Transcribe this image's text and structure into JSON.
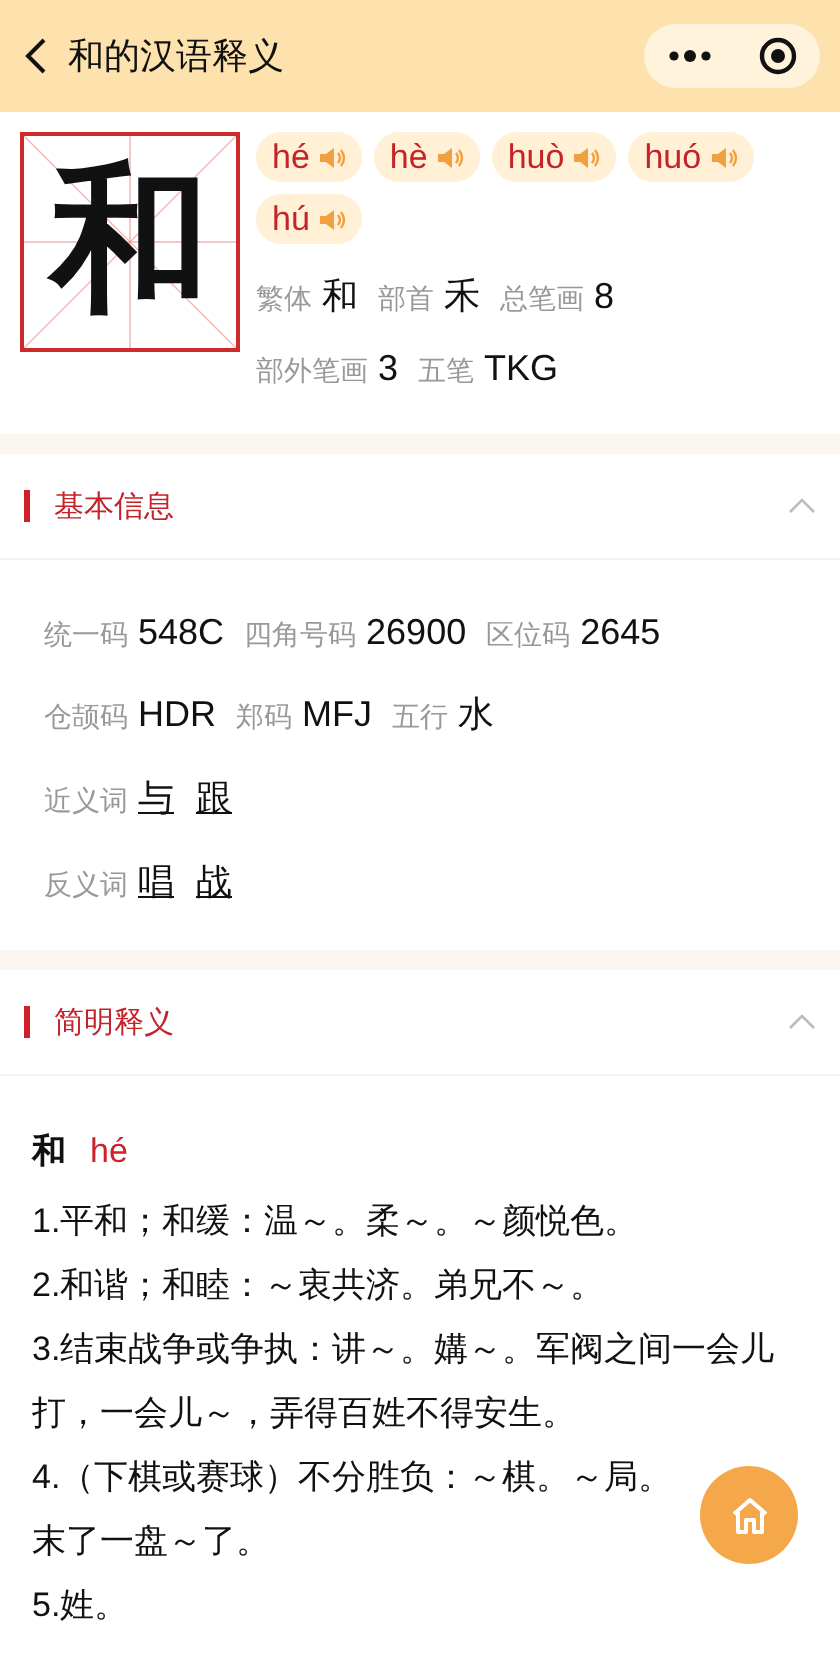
{
  "title": "和的汉语释义",
  "character": "和",
  "pronunciations": [
    {
      "pinyin": "hé"
    },
    {
      "pinyin": "hè"
    },
    {
      "pinyin": "huò"
    },
    {
      "pinyin": "huó"
    },
    {
      "pinyin": "hú"
    }
  ],
  "attribute_lines": [
    {
      "pairs": [
        {
          "label": "繁体",
          "value": "和"
        },
        {
          "label": "部首",
          "value": "禾"
        },
        {
          "label": "总笔画",
          "value": "8"
        }
      ]
    },
    {
      "pairs": [
        {
          "label": "部外笔画",
          "value": "3"
        },
        {
          "label": "五笔",
          "value": "TKG"
        }
      ]
    }
  ],
  "basic_info": {
    "title": "基本信息",
    "expanded": true,
    "lines": [
      {
        "pairs": [
          {
            "label": "统一码",
            "value": "548C"
          },
          {
            "label": "四角号码",
            "value": "26900"
          },
          {
            "label": "区位码",
            "value": "2645"
          }
        ]
      },
      {
        "pairs": [
          {
            "label": "仓颉码",
            "value": "HDR"
          },
          {
            "label": "郑码",
            "value": "MFJ"
          },
          {
            "label": "五行",
            "value": "水"
          }
        ]
      }
    ],
    "word_rows": [
      {
        "label": "近义词",
        "words": [
          "与",
          "跟"
        ]
      },
      {
        "label": "反义词",
        "words": [
          "唱",
          "战"
        ]
      }
    ]
  },
  "definitions": {
    "title": "简明释义",
    "expanded": true,
    "headword": "和",
    "pinyin": "hé",
    "items": [
      "1.平和；和缓：温～。柔～。～颜悦色。",
      "2.和谐；和睦：～衷共济。弟兄不～。",
      "3.结束战争或争执：讲～。媾～。军阀之间一会儿打，一会儿～，弄得百姓不得安生。",
      "4.（下棋或赛球）不分胜负：～棋。～局。末了一盘～了。",
      "5.姓。"
    ]
  }
}
